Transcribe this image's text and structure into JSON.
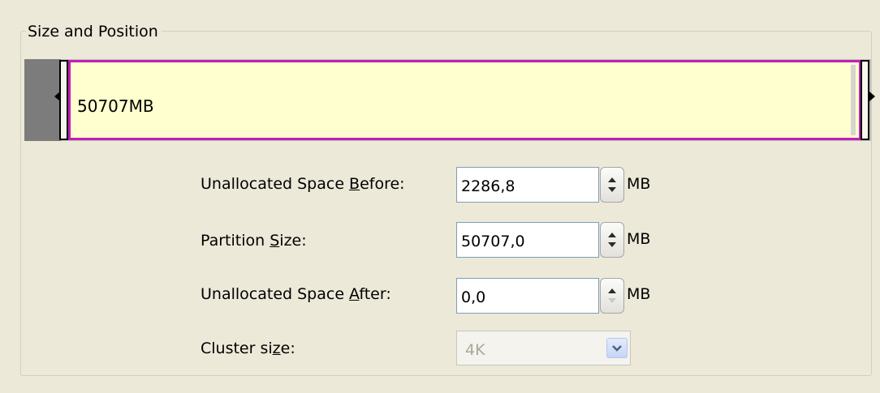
{
  "groupbox": {
    "title": "Size and Position"
  },
  "partition_bar": {
    "label": "50707MB",
    "colors": {
      "partition_fill": "#ffffcf",
      "partition_border": "#c01fb8",
      "unallocated": "#7c7c7c"
    }
  },
  "fields": {
    "before": {
      "label_pre": "Unallocated Space ",
      "label_accel": "B",
      "label_post": "efore:",
      "value": "2286,8",
      "unit": "MB"
    },
    "size": {
      "label_pre": "Partition ",
      "label_accel": "S",
      "label_post": "ize:",
      "value": "50707,0",
      "unit": "MB"
    },
    "after": {
      "label_pre": "Unallocated Space ",
      "label_accel": "A",
      "label_post": "fter:",
      "value": "0,0",
      "unit": "MB"
    },
    "cluster": {
      "label_pre": "Cluster si",
      "label_accel": "z",
      "label_post": "e:",
      "value": "4K"
    }
  },
  "icons": {
    "spinner": "up-down-arrows-icon",
    "dropdown": "chevron-down-icon",
    "resize_left": "arrow-left-icon",
    "resize_right": "arrow-right-icon"
  }
}
